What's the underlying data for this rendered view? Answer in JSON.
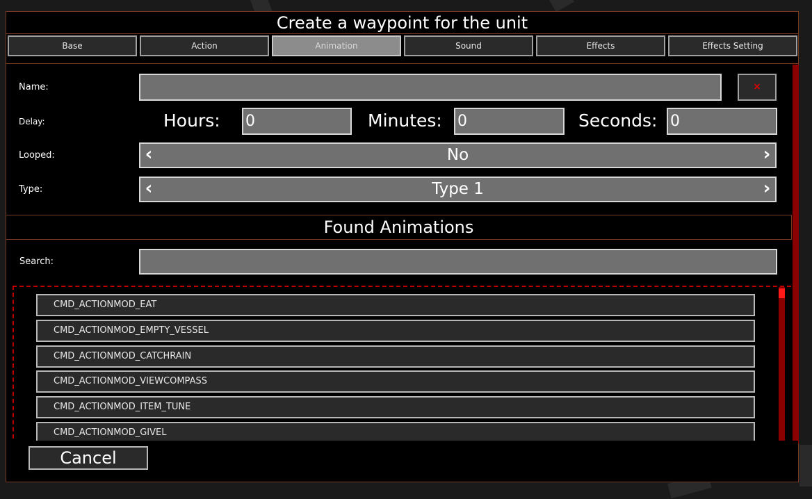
{
  "dialog": {
    "title": "Create a waypoint for the unit"
  },
  "tabs": [
    {
      "label": "Base",
      "active": false
    },
    {
      "label": "Action",
      "active": false
    },
    {
      "label": "Animation",
      "active": true
    },
    {
      "label": "Sound",
      "active": false
    },
    {
      "label": "Effects",
      "active": false
    },
    {
      "label": "Effects Setting",
      "active": false
    }
  ],
  "form": {
    "name_label": "Name:",
    "name_value": "",
    "close_label": "×",
    "delay_label": "Delay:",
    "hours_label": "Hours:",
    "hours_value": "0",
    "minutes_label": "Minutes:",
    "minutes_value": "0",
    "seconds_label": "Seconds:",
    "seconds_value": "0",
    "looped_label": "Looped:",
    "looped_value": "No",
    "type_label": "Type:",
    "type_value": "Type 1",
    "prev_arrow": "‹",
    "next_arrow": "›"
  },
  "found": {
    "header": "Found Animations",
    "search_label": "Search:",
    "search_value": "",
    "items": [
      "CMD_ACTIONMOD_EAT",
      "CMD_ACTIONMOD_EMPTY_VESSEL",
      "CMD_ACTIONMOD_CATCHRAIN",
      "CMD_ACTIONMOD_VIEWCOMPASS",
      "CMD_ACTIONMOD_ITEM_TUNE",
      "CMD_ACTIONMOD_GIVEL"
    ]
  },
  "footer": {
    "cancel_label": "Cancel"
  },
  "colors": {
    "accent_border": "#7a3a22",
    "scrollbar": "#8a0000",
    "scroll_thumb": "#ff1a1a",
    "close_x": "#e00000"
  }
}
